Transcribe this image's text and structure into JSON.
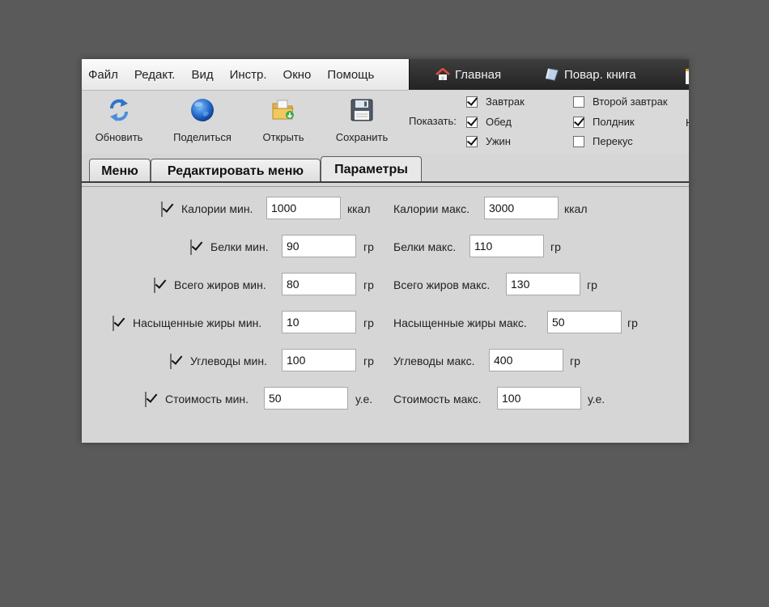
{
  "menubar": {
    "items": [
      "Файл",
      "Редакт.",
      "Вид",
      "Инстр.",
      "Окно",
      "Помощь"
    ]
  },
  "navbar": {
    "home": {
      "label": "Главная",
      "icon": "home-icon"
    },
    "cookbook": {
      "label": "Повар. книга",
      "icon": "book-icon"
    }
  },
  "toolbar": {
    "refresh": {
      "label": "Обновить",
      "icon": "refresh-icon"
    },
    "share": {
      "label": "Поделиться",
      "icon": "globe-icon"
    },
    "open": {
      "label": "Открыть",
      "icon": "folder-icon"
    },
    "save": {
      "label": "Сохранить",
      "icon": "floppy-disk-icon"
    },
    "show_label": "Показать:",
    "show_options": [
      {
        "label": "Завтрак",
        "checked": true
      },
      {
        "label": "Обед",
        "checked": true
      },
      {
        "label": "Ужин",
        "checked": true
      },
      {
        "label": "Второй завтрак",
        "checked": false
      },
      {
        "label": "Полдник",
        "checked": true
      },
      {
        "label": "Перекус",
        "checked": false
      }
    ],
    "cut_text": "Н"
  },
  "tabs": [
    {
      "label": "Меню",
      "active": false
    },
    {
      "label": "Редактировать меню",
      "active": false
    },
    {
      "label": "Параметры",
      "active": true
    }
  ],
  "params": [
    {
      "min_label": "Калории мин.",
      "min_value": "1000",
      "max_label": "Калории макс.",
      "max_value": "3000",
      "unit": "ккал",
      "checked": true
    },
    {
      "min_label": "Белки мин.",
      "min_value": "90",
      "max_label": "Белки макс.",
      "max_value": "110",
      "unit": "гр",
      "checked": true
    },
    {
      "min_label": "Всего жиров мин.",
      "min_value": "80",
      "max_label": "Всего жиров макс.",
      "max_value": "130",
      "unit": "гр",
      "checked": true
    },
    {
      "min_label": "Насыщенные жиры мин.",
      "min_value": "10",
      "max_label": "Насыщенные жиры макс.",
      "max_value": "50",
      "unit": "гр",
      "checked": true
    },
    {
      "min_label": "Углеводы мин.",
      "min_value": "100",
      "max_label": "Углеводы макс.",
      "max_value": "400",
      "unit": "гр",
      "checked": true
    },
    {
      "min_label": "Стоимость мин.",
      "min_value": "50",
      "max_label": "Стоимость макс.",
      "max_value": "100",
      "unit": "у.е.",
      "checked": true
    }
  ],
  "colors": {
    "background": "#5a5a5a",
    "window": "#d6d6d6",
    "navbar": "#2e2e2e",
    "home_accent": "#d9453a"
  }
}
